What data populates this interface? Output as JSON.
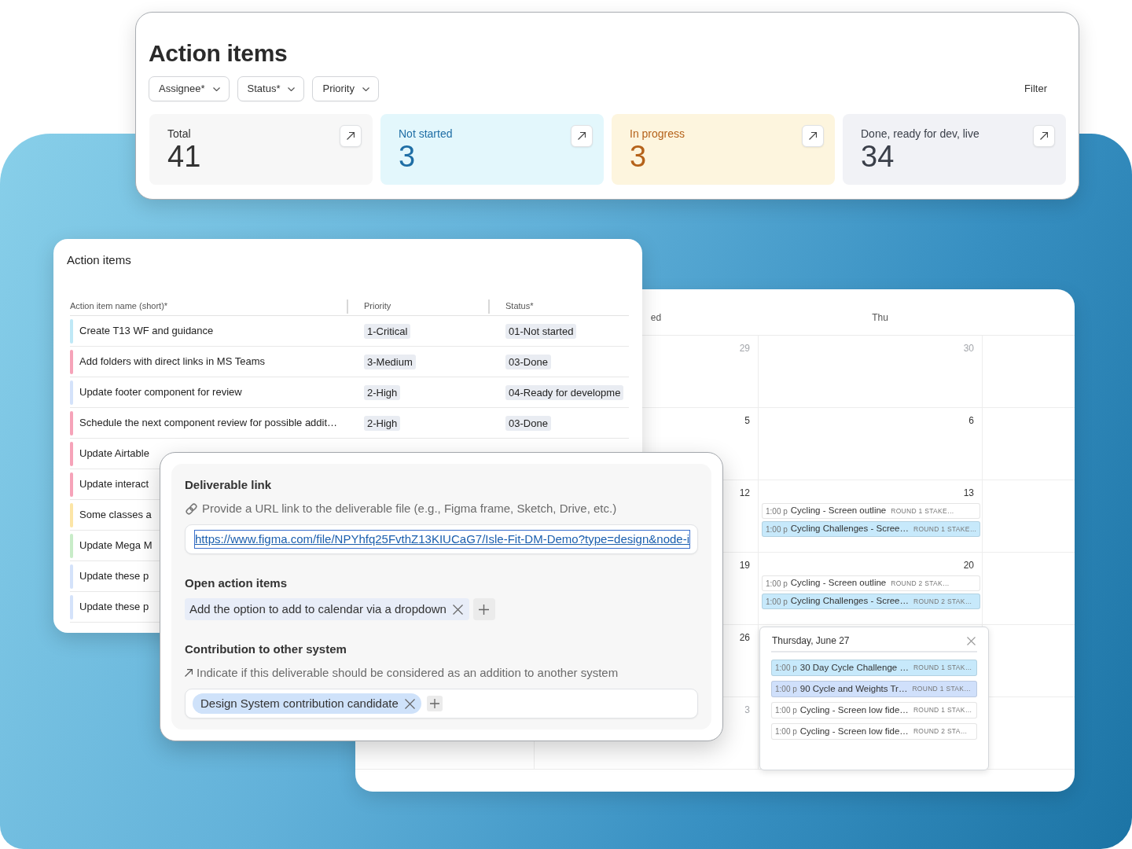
{
  "summary": {
    "title": "Action items",
    "filters": [
      "Assignee*",
      "Status*",
      "Priority"
    ],
    "filter_link": "Filter",
    "stats": [
      {
        "kind": "total",
        "label": "Total",
        "value": "41"
      },
      {
        "kind": "not_started",
        "label": "Not started",
        "value": "3"
      },
      {
        "kind": "in_progress",
        "label": "In progress",
        "value": "3"
      },
      {
        "kind": "done",
        "label": "Done, ready for dev, live",
        "value": "34"
      }
    ]
  },
  "calendar": {
    "headers": [
      "ed",
      "Thu"
    ],
    "weeks": [
      {
        "cells": [
          {
            "date": "29",
            "muted": true
          },
          {
            "date": "30",
            "muted": true
          }
        ]
      },
      {
        "cells": [
          {
            "date": "5",
            "muted": false
          },
          {
            "date": "6",
            "muted": false
          }
        ]
      },
      {
        "cells": [
          {
            "date": "12",
            "muted": false
          },
          {
            "date": "13",
            "muted": false,
            "events": [
              {
                "time": "1:00 p",
                "title": "Cycling - Screen outline",
                "tag": "ROUND 1 STAKE…",
                "color": "#ffffff"
              },
              {
                "time": "1:00 p",
                "title": "Cycling Challenges - Scree…",
                "tag": "ROUND 1 STAKE…",
                "color": "#c7e9fb"
              }
            ]
          }
        ]
      },
      {
        "cells": [
          {
            "date": "19",
            "muted": false
          },
          {
            "date": "20",
            "muted": false,
            "events": [
              {
                "time": "1:00 p",
                "title": "Cycling - Screen outline",
                "tag": "ROUND 2 STAK…",
                "color": "#ffffff"
              },
              {
                "time": "1:00 p",
                "title": "Cycling Challenges - Scree…",
                "tag": "ROUND 2 STAK…",
                "color": "#c7e9fb"
              }
            ]
          }
        ]
      },
      {
        "cells": [
          {
            "date": "26",
            "muted": false
          },
          {}
        ]
      },
      {
        "cells": [
          {
            "date": "3",
            "muted": true
          },
          {}
        ]
      }
    ],
    "day_popup": {
      "title": "Thursday, June 27",
      "events": [
        {
          "time": "1:00 p",
          "title": "30 Day Cycle Challenge …",
          "tag": "ROUND 1 STAK…",
          "color": "#c7e9fb"
        },
        {
          "time": "1:00 p",
          "title": "90 Cycle and Weights Tr…",
          "tag": "ROUND 1 STAK…",
          "color": "#d0e0fb"
        },
        {
          "time": "1:00 p",
          "title": "Cycling - Screen low fide…",
          "tag": "ROUND 1 STAK…",
          "color": "#ffffff"
        },
        {
          "time": "1:00 p",
          "title": "Cycling - Screen low fide…",
          "tag": "ROUND 2 STA…",
          "color": "#ffffff"
        }
      ]
    }
  },
  "table": {
    "title": "Action items",
    "columns": [
      "Action item name (short)*",
      "Priority",
      "Status*"
    ],
    "rows": [
      {
        "color": "#bfe8f6",
        "name": "Create T13 WF and guidance",
        "priority": "1-Critical",
        "status": "01-Not started"
      },
      {
        "color": "#f6a3b9",
        "name": "Add folders with direct links in MS Teams",
        "priority": "3-Medium",
        "status": "03-Done"
      },
      {
        "color": "#d4e2fa",
        "name": "Update footer component for review",
        "priority": "2-High",
        "status": "04-Ready for developme"
      },
      {
        "color": "#f6a3b9",
        "name": "Schedule the next component review for possible addit…",
        "priority": "2-High",
        "status": "03-Done"
      },
      {
        "color": "#f6a3b9",
        "name": "Update Airtable"
      },
      {
        "color": "#f6a3b9",
        "name": "Update interact"
      },
      {
        "color": "#fce5a6",
        "name": "Some classes a"
      },
      {
        "color": "#c8ecc8",
        "name": "Update Mega M"
      },
      {
        "color": "#d4e2fa",
        "name": "Update these p"
      },
      {
        "color": "#d4e2fa",
        "name": "Update these p"
      }
    ]
  },
  "detail": {
    "sections": [
      {
        "kind": "link",
        "title": "Deliverable link",
        "hint": "Provide a URL link to the deliverable file (e.g., Figma frame, Sketch, Drive, etc.)",
        "value": "https://www.figma.com/file/NPYhfq25FvthZ13KIUCaG7/Isle-Fit-DM-Demo?type=design&node-i"
      },
      {
        "kind": "tags",
        "title": "Open action items",
        "tags": [
          "Add the option to add to calendar via a dropdown"
        ]
      },
      {
        "kind": "tag_field",
        "title": "Contribution to other system",
        "hint": "Indicate if this deliverable should be considered as an addition to another system",
        "tags": [
          "Design System contribution candidate"
        ]
      }
    ]
  }
}
